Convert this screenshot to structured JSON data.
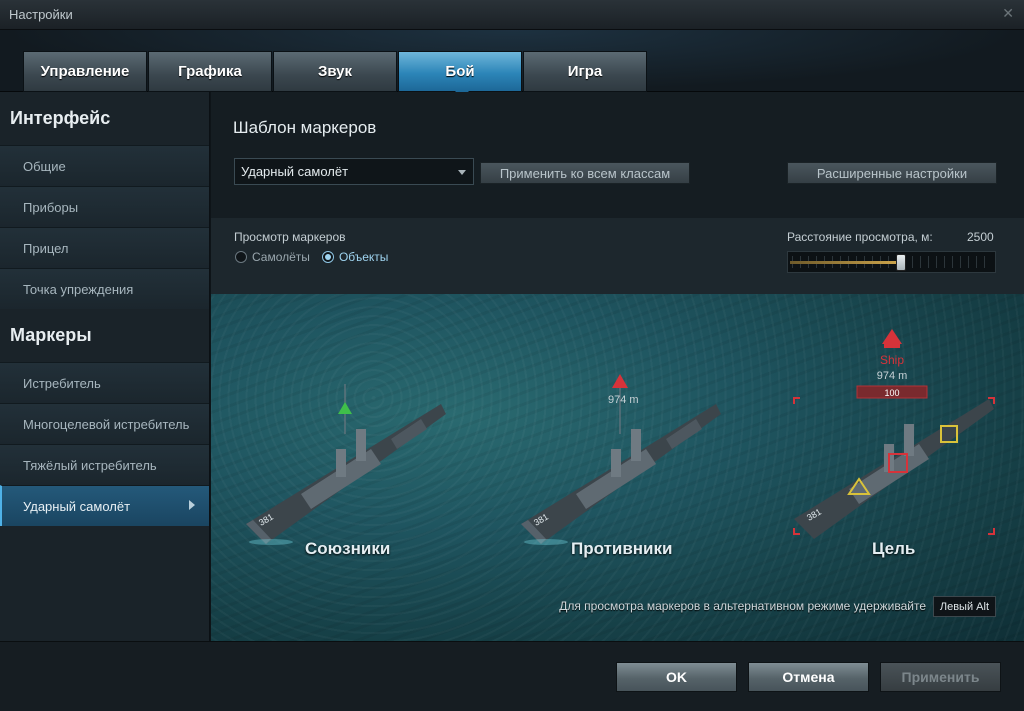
{
  "window": {
    "title": "Настройки"
  },
  "tabs": [
    {
      "label": "Управление",
      "active": false
    },
    {
      "label": "Графика",
      "active": false
    },
    {
      "label": "Звук",
      "active": false
    },
    {
      "label": "Бой",
      "active": true
    },
    {
      "label": "Игра",
      "active": false
    }
  ],
  "sidebar": {
    "interface_heading": "Интерфейс",
    "interface_items": [
      "Общие",
      "Приборы",
      "Прицел",
      "Точка упреждения"
    ],
    "markers_heading": "Маркеры",
    "markers_items": [
      "Истребитель",
      "Многоцелевой истребитель",
      "Тяжёлый истребитель",
      "Ударный самолёт"
    ],
    "active_item": "Ударный самолёт"
  },
  "main": {
    "title": "Шаблон маркеров",
    "dropdown_value": "Ударный самолёт",
    "apply_all_label": "Применить ко всем классам",
    "advanced_label": "Расширенные настройки",
    "preview_label": "Просмотр маркеров",
    "radio_planes": "Самолёты",
    "radio_objects": "Объекты",
    "radio_selected": "objects",
    "distance_label": "Расстояние просмотра, м:",
    "distance_value": "2500",
    "distance_fraction": 0.55
  },
  "preview": {
    "allies_label": "Союзники",
    "enemies_label": "Противники",
    "target_label": "Цель",
    "enemy_distance": "974 m",
    "target_name": "Ship",
    "target_distance": "974 m",
    "target_health": "100",
    "ship_number": "381",
    "colors": {
      "ally": "#3fbf4a",
      "enemy": "#d6333a",
      "target_frame": "#d6333a",
      "target_box": "#d9c23a"
    },
    "note": "Для просмотра маркеров в альтернативном режиме удерживайте",
    "key": "Левый Alt"
  },
  "footer": {
    "ok": "OK",
    "cancel": "Отмена",
    "apply": "Применить"
  }
}
